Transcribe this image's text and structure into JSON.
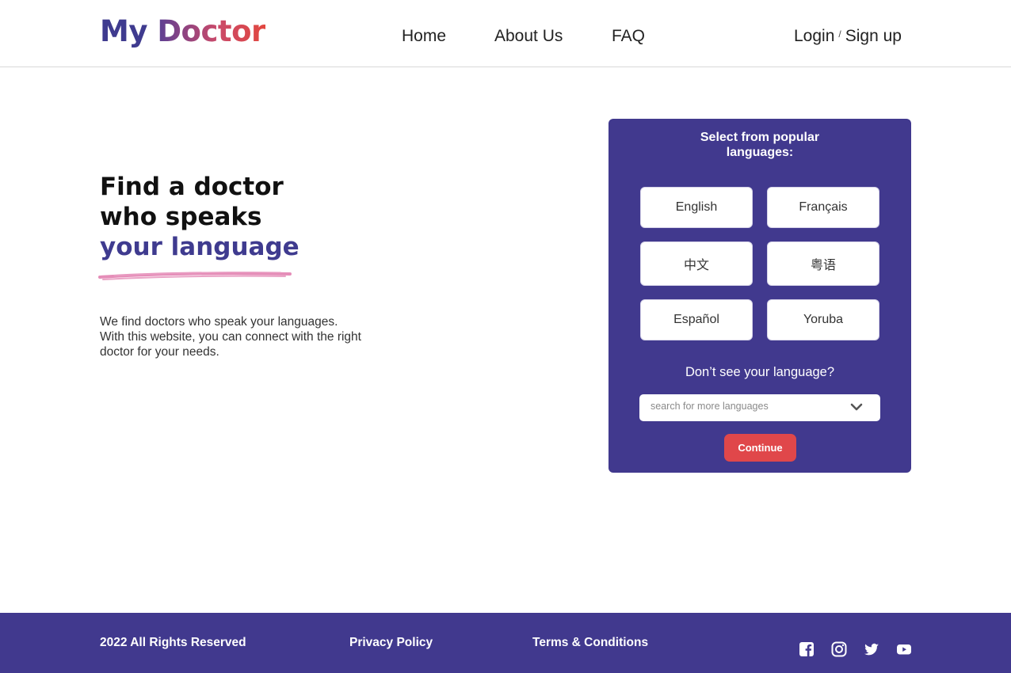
{
  "header": {
    "logo_part1": "My",
    "logo_part2": "Doctor",
    "nav": [
      "Home",
      "About Us",
      "FAQ"
    ],
    "login": "Login",
    "separator": "/",
    "signup": "Sign up"
  },
  "hero": {
    "title_line1": "Find a doctor",
    "title_line2": "who speaks",
    "title_line3": "your language",
    "description": "We find doctors who speak your languages. With this website, you can connect with the right doctor for your needs."
  },
  "panel": {
    "title_line1": "Select from popular",
    "title_line2": "languages:",
    "languages": [
      "English",
      "Français",
      "中文",
      "粤语",
      "Español",
      "Yoruba"
    ],
    "dont_see": "Don’t see your language?",
    "search_placeholder": "search for more languages",
    "continue_label": "Continue"
  },
  "footer": {
    "copyright": "2022 All Rights Reserved",
    "privacy": "Privacy Policy",
    "terms": "Terms & Conditions",
    "social_icons": [
      "facebook-icon",
      "instagram-icon",
      "twitter-icon",
      "youtube-icon"
    ]
  },
  "colors": {
    "brand_purple": "#41398e",
    "accent_red": "#e0474a",
    "underline_pink": "#e58db8"
  }
}
